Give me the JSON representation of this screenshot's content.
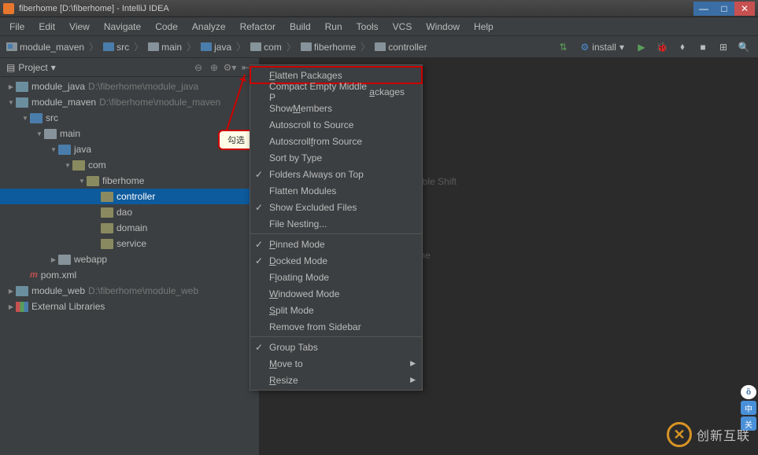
{
  "titlebar": {
    "text": "fiberhome [D:\\fiberhome] - IntelliJ IDEA"
  },
  "menubar": [
    "File",
    "Edit",
    "View",
    "Navigate",
    "Code",
    "Analyze",
    "Refactor",
    "Build",
    "Run",
    "Tools",
    "VCS",
    "Window",
    "Help"
  ],
  "breadcrumb": [
    "module_maven",
    "src",
    "main",
    "java",
    "com",
    "fiberhome",
    "controller"
  ],
  "run_config": "install",
  "sidebar": {
    "title": "Project",
    "items": [
      {
        "depth": 0,
        "arrow": "right",
        "icon": "module",
        "label": "module_java",
        "path": "D:\\fiberhome\\module_java"
      },
      {
        "depth": 0,
        "arrow": "down",
        "icon": "module",
        "label": "module_maven",
        "path": "D:\\fiberhome\\module_maven"
      },
      {
        "depth": 1,
        "arrow": "down",
        "icon": "srcfolder",
        "label": "src"
      },
      {
        "depth": 2,
        "arrow": "down",
        "icon": "folder",
        "label": "main"
      },
      {
        "depth": 3,
        "arrow": "down",
        "icon": "srcfolder",
        "label": "java"
      },
      {
        "depth": 4,
        "arrow": "down",
        "icon": "package",
        "label": "com"
      },
      {
        "depth": 5,
        "arrow": "down",
        "icon": "package",
        "label": "fiberhome"
      },
      {
        "depth": 6,
        "arrow": "",
        "icon": "package",
        "label": "controller",
        "selected": true
      },
      {
        "depth": 6,
        "arrow": "",
        "icon": "package",
        "label": "dao"
      },
      {
        "depth": 6,
        "arrow": "",
        "icon": "package",
        "label": "domain"
      },
      {
        "depth": 6,
        "arrow": "",
        "icon": "package",
        "label": "service"
      },
      {
        "depth": 3,
        "arrow": "right",
        "icon": "folder",
        "label": "webapp"
      },
      {
        "depth": 1,
        "arrow": "",
        "icon": "maven",
        "label": "pom.xml"
      },
      {
        "depth": 0,
        "arrow": "right",
        "icon": "module",
        "label": "module_web",
        "path": "D:\\fiberhome\\module_web"
      },
      {
        "depth": 0,
        "arrow": "right",
        "icon": "lib",
        "label": "External Libraries"
      }
    ]
  },
  "hints": {
    "a": "uble Shift",
    "b": "me"
  },
  "context_menu": [
    {
      "label": "Flatten Packages",
      "highlighted": true,
      "u": 0
    },
    {
      "label": "Compact Empty Middle Packages",
      "u": 22
    },
    {
      "label": "Show Members",
      "u": 5
    },
    {
      "label": "Autoscroll to Source"
    },
    {
      "label": "Autoscroll from Source",
      "u": 11
    },
    {
      "label": "Sort by Type"
    },
    {
      "label": "Folders Always on Top",
      "checked": true
    },
    {
      "label": "Flatten Modules"
    },
    {
      "label": "Show Excluded Files",
      "checked": true
    },
    {
      "label": "File Nesting..."
    },
    {
      "sep": true
    },
    {
      "label": "Pinned Mode",
      "checked": true,
      "u": 0
    },
    {
      "label": "Docked Mode",
      "checked": true,
      "u": 0
    },
    {
      "label": "Floating Mode",
      "u": 1
    },
    {
      "label": "Windowed Mode",
      "u": 0
    },
    {
      "label": "Split Mode",
      "u": 0
    },
    {
      "label": "Remove from Sidebar"
    },
    {
      "sep": true
    },
    {
      "label": "Group Tabs",
      "checked": true
    },
    {
      "label": "Move to",
      "sub": true,
      "u": 0
    },
    {
      "label": "Resize",
      "sub": true,
      "u": 0
    }
  ],
  "callout": "勾选",
  "watermark": "创新互联"
}
